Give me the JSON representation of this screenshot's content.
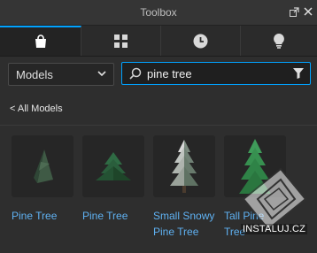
{
  "window": {
    "title": "Toolbox",
    "undock_icon": "undock-icon",
    "close_icon": "close-icon"
  },
  "tabs": [
    {
      "icon": "marketplace-bag-icon",
      "active": true
    },
    {
      "icon": "grid-icon",
      "active": false
    },
    {
      "icon": "clock-icon",
      "active": false
    },
    {
      "icon": "lightbulb-icon",
      "active": false
    }
  ],
  "category": {
    "selected": "Models"
  },
  "search": {
    "value": "pine tree"
  },
  "nav": {
    "back_label": "< All Models"
  },
  "results": [
    {
      "label": "Pine Tree",
      "thumb": "dark-pine"
    },
    {
      "label": "Pine Tree",
      "thumb": "green-pine"
    },
    {
      "label": "Small Snowy Pine Tree",
      "thumb": "snowy-pine"
    },
    {
      "label": "Tall Pine Tree",
      "thumb": "tall-pine"
    }
  ],
  "watermark": {
    "text": "INSTALUJ.CZ"
  },
  "colors": {
    "accent": "#00a2ff",
    "link": "#5fb1f2",
    "background": "#2e2e2e"
  }
}
